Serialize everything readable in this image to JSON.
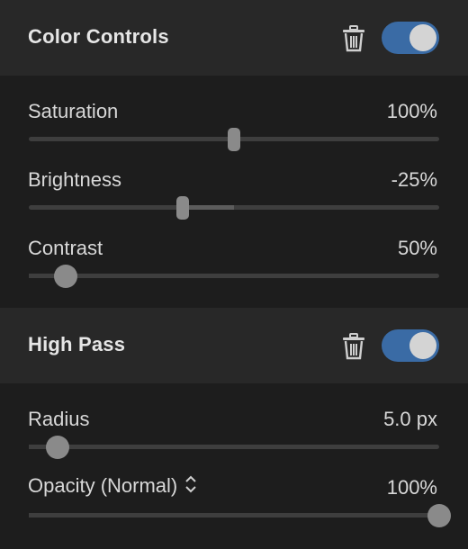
{
  "sections": [
    {
      "title": "Color Controls",
      "trash_icon": "trash-icon",
      "enabled": true,
      "controls": [
        {
          "label": "Saturation",
          "value": "100%",
          "level": 0.5,
          "style": "center"
        },
        {
          "label": "Brightness",
          "value": "-25%",
          "level": 0.375,
          "style": "center"
        },
        {
          "label": "Contrast",
          "value": "50%",
          "level": 0.09,
          "style": "left"
        }
      ]
    },
    {
      "title": "High Pass",
      "trash_icon": "trash-icon",
      "enabled": true,
      "controls": [
        {
          "label": "Radius",
          "value": "5.0 px",
          "level": 0.07,
          "style": "left"
        },
        {
          "label": "Opacity (Normal)",
          "value": "100%",
          "level": 1.0,
          "style": "left",
          "dropdown_icon": "updown-chevron-icon"
        }
      ]
    }
  ],
  "colors": {
    "background": "#1d1d1d",
    "header": "#282828",
    "toggle_on": "#3a6ba5",
    "track": "#3e3e3e",
    "thumb": "#8a8a8a"
  }
}
